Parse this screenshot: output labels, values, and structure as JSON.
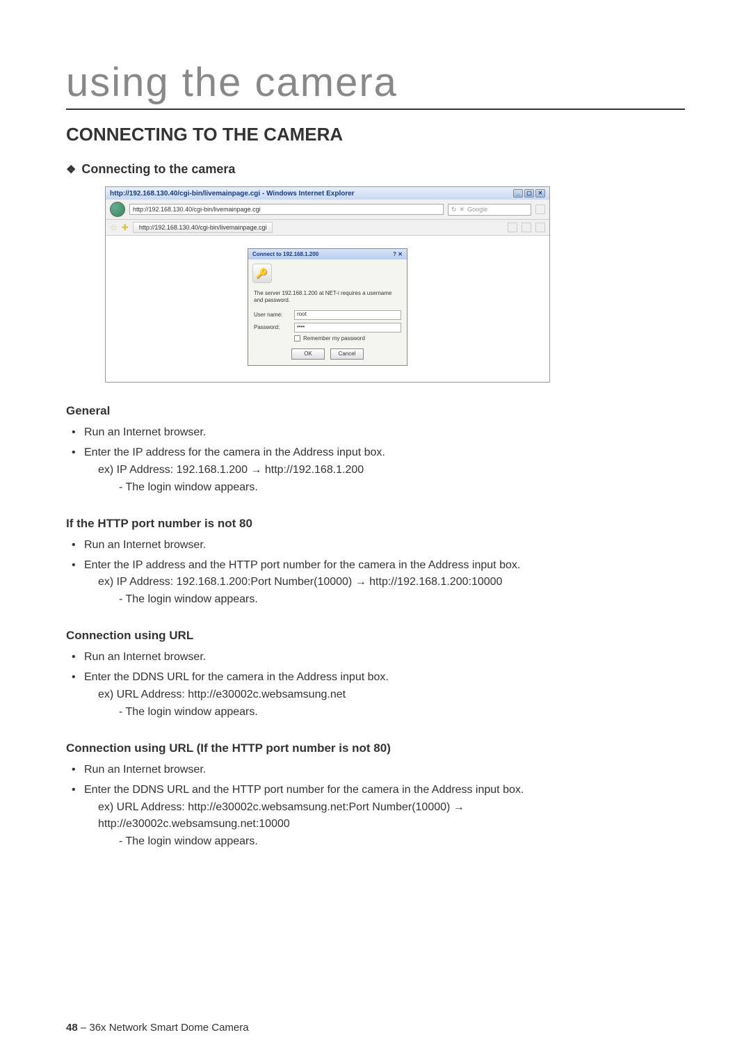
{
  "chapterTitle": "using the camera",
  "sectionTitle": "CONNECTING TO THE CAMERA",
  "subsection1": "Connecting to the camera",
  "screenshot": {
    "windowTitle": "http://192.168.130.40/cgi-bin/livemainpage.cgi - Windows Internet Explorer",
    "url": "http://192.168.130.40/cgi-bin/livemainpage.cgi",
    "searchPlaceholder": "Google",
    "tabLabel": "http://192.168.130.40/cgi-bin/livemainpage.cgi",
    "auth": {
      "title": "Connect to 192.168.1.200",
      "message": "The server 192.168.1.200 at NET-i requires a username and password.",
      "userLabel": "User name:",
      "userValue": "root",
      "passLabel": "Password:",
      "passValue": "••••",
      "remember": "Remember my password",
      "ok": "OK",
      "cancel": "Cancel"
    }
  },
  "sections": {
    "general": {
      "heading": "General",
      "b1": "Run an Internet browser.",
      "b2a": "Enter the IP address for the camera in the Address input box.",
      "b2b": "ex) IP Address: 192.168.1.200 → http://192.168.1.200",
      "b2c": "- The login window appears."
    },
    "httpNot80": {
      "heading": "If the HTTP port number is not 80",
      "b1": "Run an Internet browser.",
      "b2a": "Enter the IP address and the HTTP port number for the camera in the Address input box.",
      "b2b": "ex) IP Address: 192.168.1.200:Port Number(10000) → http://192.168.1.200:10000",
      "b2c": "- The login window appears."
    },
    "connUrl": {
      "heading": "Connection using URL",
      "b1": "Run an Internet browser.",
      "b2a": "Enter the DDNS URL for the camera in the Address input box.",
      "b2b": "ex) URL Address: http://e30002c.websamsung.net",
      "b2c": "- The login window appears."
    },
    "connUrlNot80": {
      "heading": "Connection using URL (If the HTTP port number is not 80)",
      "b1": "Run an Internet browser.",
      "b2a": "Enter the DDNS URL and the HTTP port number for the camera in the Address input box.",
      "b2b": "ex) URL Address: http://e30002c.websamsung.net:Port Number(10000) →",
      "b2b2": "http://e30002c.websamsung.net:10000",
      "b2c": "- The login window appears."
    }
  },
  "footer": {
    "pageNum": "48",
    "sep": " – ",
    "product": "36x Network Smart Dome Camera"
  }
}
